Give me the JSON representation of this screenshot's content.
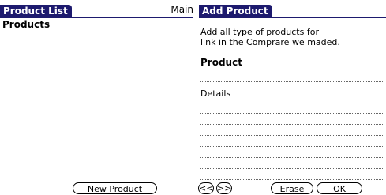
{
  "left_screen": {
    "title": "Product List",
    "category": "Main",
    "heading": "Products",
    "new_button": "New Product"
  },
  "right_screen": {
    "title": "Add Product",
    "description_line1": "Add all type of products for",
    "description_line2": "link in the Comprare we maded.",
    "product_label": "Product",
    "details_label": "Details",
    "prev_button": "<<",
    "next_button": ">>",
    "erase_button": "Erase",
    "ok_button": "OK"
  },
  "colors": {
    "title_bar": "#1d1a6e"
  }
}
